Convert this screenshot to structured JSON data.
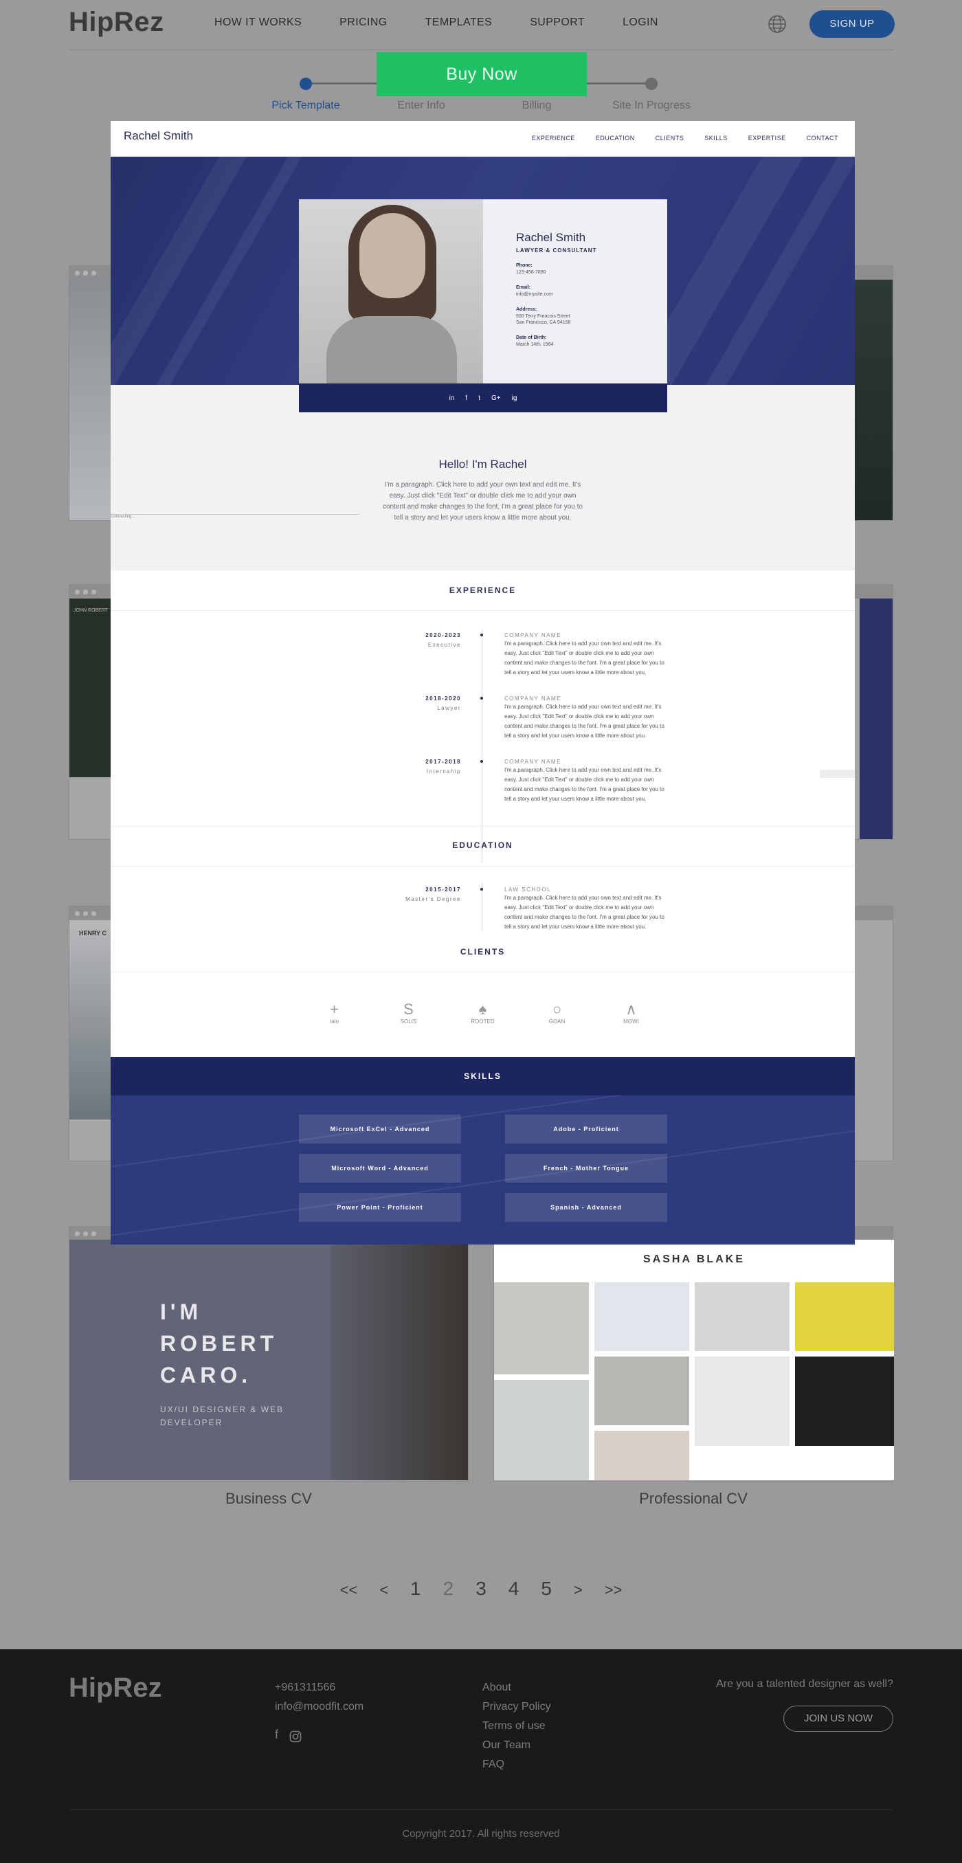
{
  "header": {
    "logo": "HipRez",
    "nav": [
      "HOW IT WORKS",
      "PRICING",
      "TEMPLATES",
      "SUPPORT",
      "LOGIN"
    ],
    "signup": "SIGN UP"
  },
  "steps": {
    "items": [
      "Pick Template",
      "Enter Info",
      "Billing",
      "Site In Progress"
    ],
    "active": 0
  },
  "buy_now": "Buy Now",
  "preview": {
    "site_name": "Rachel Smith",
    "nav": [
      "EXPERIENCE",
      "EDUCATION",
      "CLIENTS",
      "SKILLS",
      "EXPERTISE",
      "CONTACT"
    ],
    "profile": {
      "name": "Rachel Smith",
      "role": "LAWYER & CONSULTANT",
      "phone_label": "Phone:",
      "phone": "123-456-7890",
      "email_label": "Email:",
      "email": "info@mysite.com",
      "address_label": "Address:",
      "address1": "500 Terry Francois Street",
      "address2": "San Francisco, CA 94158",
      "dob_label": "Date of Birth:",
      "dob": "March 14th, 1984"
    },
    "social": [
      "in",
      "f",
      "t",
      "G+",
      "ig"
    ],
    "hello": "Hello! I'm Rachel",
    "intro": "I'm a paragraph. Click here to add your own text and edit me. It's easy. Just click \"Edit Text\" or double click me to add your own content and make changes to the font. I'm a great place for you to tell a story and let your users know a little more about you.",
    "connecting": "Connecting...",
    "experience_heading": "EXPERIENCE",
    "experience": [
      {
        "years": "2020-2023",
        "title": "Executive",
        "company": "COMPANY NAME"
      },
      {
        "years": "2018-2020",
        "title": "Lawyer",
        "company": "COMPANY NAME"
      },
      {
        "years": "2017-2018",
        "title": "Internship",
        "company": "COMPANY NAME"
      }
    ],
    "entry_desc": "I'm a paragraph. Click here to add your own text and edit me. It's easy. Just click \"Edit Text\" or double click me to add your own content and make changes to the font. I'm a great place for you to tell a story and let your users know a little more about you.",
    "education_heading": "EDUCATION",
    "education": [
      {
        "years": "2015-2017",
        "title": "Master's Degree",
        "company": "LAW SCHOOL"
      }
    ],
    "clients_heading": "CLIENTS",
    "clients": [
      "talo",
      "SOLIS",
      "ROOTED",
      "GOAN",
      "MOWI"
    ],
    "skills_heading": "SKILLS",
    "skills": [
      "Microsoft ExCel - Advanced",
      "Adobe - Proficient",
      "Microsoft Word - Advanced",
      "French - Mother Tongue",
      "Power Point - Proficient",
      "Spanish - Advanced"
    ]
  },
  "bg_card_labels": {
    "john": "JOHN ROBERT",
    "henry": "HENRY C"
  },
  "templates": [
    {
      "name": "Business CV",
      "preview_title": [
        "I'M",
        "ROBERT",
        "CARO."
      ],
      "preview_subtitle": [
        "UX/UI DESIGNER & WEB",
        "DEVELOPER"
      ]
    },
    {
      "name": "Professional CV",
      "preview_title": "SASHA BLAKE"
    }
  ],
  "pagination": [
    "<<",
    "<",
    "1",
    "2",
    "3",
    "4",
    "5",
    ">",
    ">>"
  ],
  "pagination_current": "2",
  "footer": {
    "logo": "HipRez",
    "phone": "+961311566",
    "email": "info@moodfit.com",
    "links": [
      "About",
      "Privacy Policy",
      "Terms of use",
      "Our Team",
      "FAQ"
    ],
    "designer_question": "Are you a talented designer as well?",
    "join": "JOIN US NOW",
    "copyright": "Copyright 2017. All rights reserved"
  }
}
